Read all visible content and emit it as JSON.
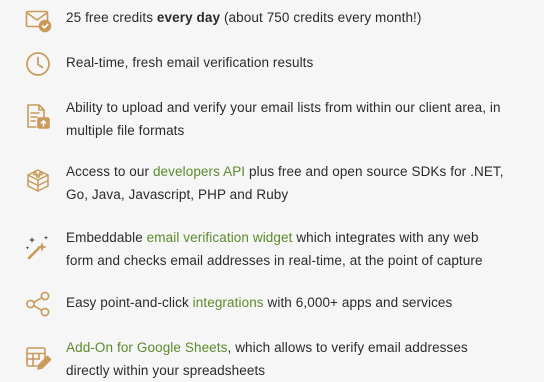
{
  "colors": {
    "icon_accent": "#c99a5a",
    "link": "#5c8a2c",
    "text": "#2b2b2b",
    "background": "#f6f6f6"
  },
  "features": [
    {
      "icon": "email-check-icon",
      "pre": "25 free credits ",
      "bold": "every day",
      "post": " (about 750 credits every month!)"
    },
    {
      "icon": "clock-icon",
      "text": "Real-time, fresh email verification results"
    },
    {
      "icon": "file-upload-icon",
      "line1": "Ability to upload and verify your email lists from within our client area, in",
      "line2": "multiple file formats"
    },
    {
      "icon": "sdk-blocks-icon",
      "pre": "Access to our ",
      "link": "developers API",
      "post": " plus free and open source SDKs for .NET,",
      "line2": "Go, Java, Javascript, PHP and Ruby"
    },
    {
      "icon": "magic-wand-icon",
      "pre": "Embeddable ",
      "link": "email verification widget",
      "post": " which integrates with any web",
      "line2": "form and checks email addresses in real-time, at the point of capture"
    },
    {
      "icon": "share-nodes-icon",
      "pre": "Easy point-and-click ",
      "link": "integrations",
      "post": " with 6,000+ apps and services"
    },
    {
      "icon": "spreadsheet-edit-icon",
      "link": "Add-On for Google Sheets",
      "post": ", which allows to verify email addresses",
      "line2": "directly within your spreadsheets"
    }
  ]
}
